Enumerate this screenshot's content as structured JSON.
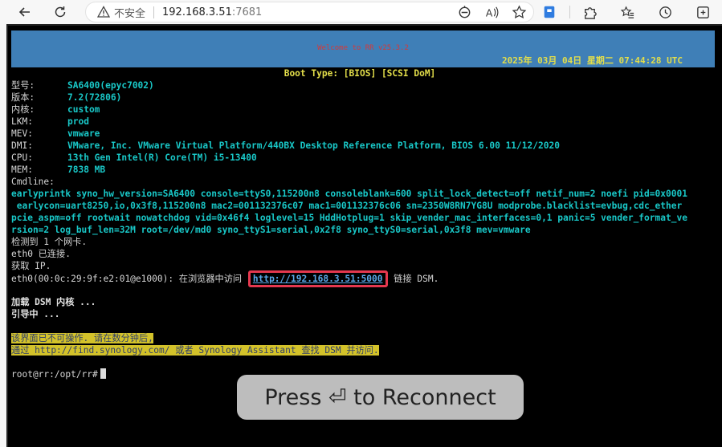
{
  "browser": {
    "security_label": "不安全",
    "url_host": "192.168.3.51",
    "url_port": ":7681"
  },
  "terminal": {
    "banner_welcome": "Welcome to RR v25.3.2",
    "banner_datetime": "2025年 03月 04日 星期二 07:44:28 UTC",
    "boot_type": "Boot Type: [BIOS] [SCSI DoM]",
    "info": [
      {
        "key": "型号:",
        "value": "SA6400(epyc7002)"
      },
      {
        "key": "版本:",
        "value": "7.2(72806)"
      },
      {
        "key": "内核:",
        "value": "custom"
      },
      {
        "key": "LKM:",
        "value": "prod"
      },
      {
        "key": "MEV:",
        "value": "vmware"
      },
      {
        "key": "DMI:",
        "value": "VMware, Inc. VMware Virtual Platform/440BX Desktop Reference Platform, BIOS 6.00 11/12/2020"
      },
      {
        "key": "CPU:",
        "value": "13th Gen Intel(R) Core(TM) i5-13400"
      },
      {
        "key": "MEM:",
        "value": "7838 MB"
      }
    ],
    "cmdline_label": "Cmdline:",
    "cmdline_lines": [
      "earlyprintk syno_hw_version=SA6400 console=ttyS0,115200n8 consoleblank=600 split_lock_detect=off netif_num=2 noefi pid=0x0001",
      " earlycon=uart8250,io,0x3f8,115200n8 mac2=001132376c07 mac1=001132376c06 sn=2350W8RN7YG8U modprobe.blacklist=evbug,cdc_ether",
      "pcie_aspm=off rootwait nowatchdog vid=0x46f4 loglevel=15 HddHotplug=1 skip_vender_mac_interfaces=0,1 panic=5 vender_format_ve",
      "rsion=2 log_buf_len=32M root=/dev/md0 syno_ttyS1=serial,0x2f8 syno_ttyS0=serial,0x3f8 mev=vmware"
    ],
    "net_lines": [
      "检测到 1 个网卡.",
      "eth0 已连接.",
      "获取 IP."
    ],
    "eth0_prefix": "eth0(00:0c:29:9f:e2:01@e1000): 在浏览器中访问 ",
    "dsm_link": "http://192.168.3.51:5000",
    "eth0_suffix": " 链接 DSM.",
    "loading_line1": "加载 DSM 内核 ...",
    "loading_line2": "引导中 ...",
    "warning_line1": "该界面已不可操作. 请在数分钟后,",
    "warning_line2": "通过 http://find.synology.com/ 或者 Synology Assistant 查找 DSM 并访问.",
    "prompt": "root@rr:/opt/rr#"
  },
  "reconnect_text": "Press ⏎ to Reconnect",
  "icons": [
    "back-icon",
    "reload-icon",
    "warning-icon",
    "read-aloud-icon",
    "favorite-icon",
    "extension-icon",
    "puzzle-icon",
    "favorites-bar-icon",
    "history-icon",
    "refresh-translate-icon"
  ]
}
